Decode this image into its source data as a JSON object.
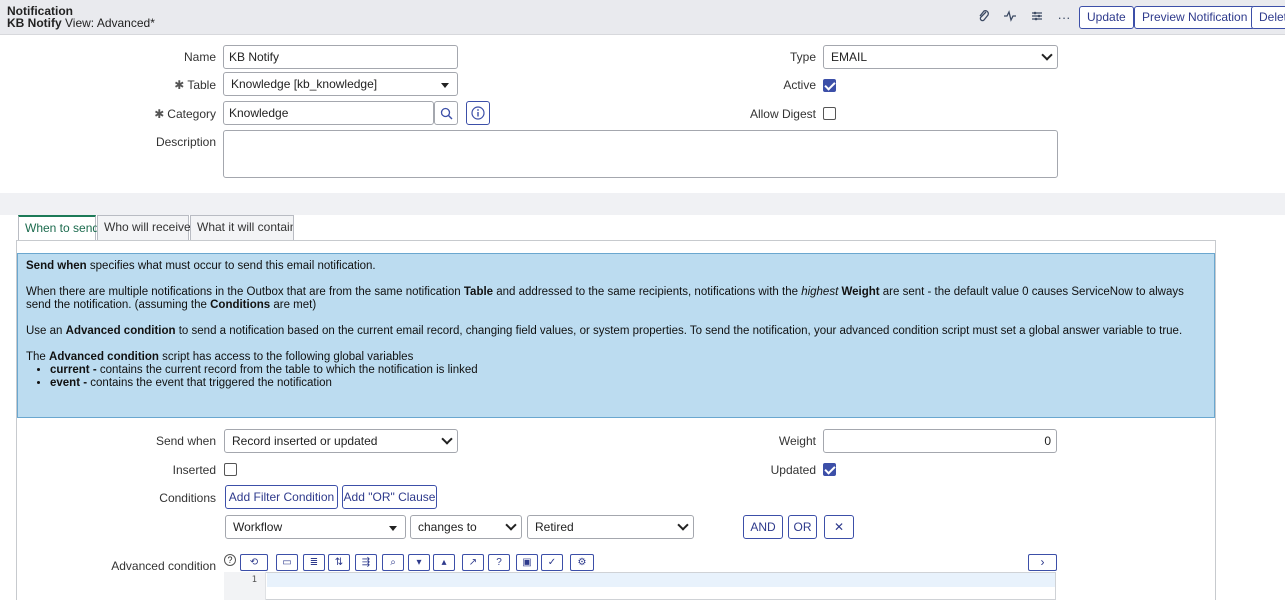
{
  "header": {
    "title": "Notification",
    "record": "KB Notify",
    "view": "View: Advanced*",
    "buttons": {
      "update": "Update",
      "preview": "Preview Notification",
      "delete": "Delet"
    }
  },
  "form": {
    "name_label": "Name",
    "name_value": "KB Notify",
    "table_label": "Table",
    "table_value": "Knowledge [kb_knowledge]",
    "category_label": "Category",
    "category_value": "Knowledge",
    "description_label": "Description",
    "description_value": "",
    "type_label": "Type",
    "type_value": "EMAIL",
    "active_label": "Active",
    "active_checked": true,
    "allow_digest_label": "Allow Digest",
    "allow_digest_checked": false,
    "required_mark": "✱"
  },
  "tabs": [
    "When to send",
    "Who will receive",
    "What it will contain"
  ],
  "info": {
    "p1_b": "Send when",
    "p1": " specifies what must occur to send this email notification.",
    "p2a": "When there are multiple notifications in the Outbox that are from the same notification ",
    "p2_table": "Table",
    "p2b": " and addressed to the same recipients, notifications with the ",
    "p2_highest": "highest",
    "p2_weight": " Weight",
    "p2c": " are sent - the default value 0 causes ServiceNow to always send the notification. (assuming the ",
    "p2_cond": "Conditions",
    "p2d": " are met)",
    "p3a": "Use an ",
    "p3_b": "Advanced condition",
    "p3b": " to send a notification based on the current email record, changing field values, or system properties. To send the notification, your advanced condition script must set a global answer variable to true.",
    "p4a": "The ",
    "p4_b": "Advanced condition",
    "p4b": " script has access to the following global variables",
    "li1_b": "current -",
    "li1": " contains the current record from the table to which the notification is linked",
    "li2_b": "event -",
    "li2": " contains the event that triggered the notification"
  },
  "when": {
    "send_when_label": "Send when",
    "send_when_value": "Record inserted or updated",
    "weight_label": "Weight",
    "weight_value": "0",
    "inserted_label": "Inserted",
    "inserted_checked": false,
    "updated_label": "Updated",
    "updated_checked": true,
    "conditions_label": "Conditions",
    "add_filter": "Add Filter Condition",
    "add_or": "Add \"OR\" Clause",
    "cond_field": "Workflow",
    "cond_op": "changes to",
    "cond_value": "Retired",
    "and": "AND",
    "or": "OR",
    "remove": "✕",
    "advanced_label": "Advanced condition",
    "line_number": "1"
  }
}
